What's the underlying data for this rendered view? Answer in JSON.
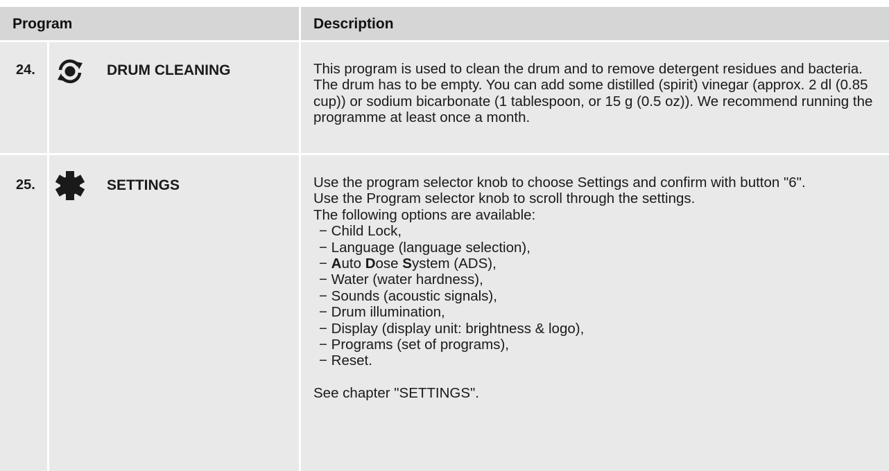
{
  "header": {
    "program_label": "Program",
    "description_label": "Description"
  },
  "rows": [
    {
      "number": "24.",
      "icon": "drum-cleaning-icon",
      "name": "DRUM CLEANING",
      "description": "This program is used to clean the drum and to remove detergent residues and bacteria. The drum has to be empty. You can add some distilled (spirit) vinegar (approx. 2 dl (0.85 cup)) or sodium bicarbonate (1 tablespoon, or 15 g (0.5 oz)). We recommend running the programme at least once a month."
    },
    {
      "number": "25.",
      "icon": "gear-icon",
      "name": "SETTINGS",
      "intro_lines": [
        "Use the program selector knob to choose Settings and confirm with button \"6\".",
        "Use the Program selector knob to scroll through the settings.",
        "The following options are available:"
      ],
      "options": [
        "Child Lock,",
        "Language (language selection),",
        "Water (water hardness),",
        "Sounds (acoustic signals),",
        "Drum illumination,",
        "Display (display unit: brightness & logo),",
        "Programs (set of programs),",
        "Reset."
      ],
      "ads_option": {
        "a_bold": "A",
        "a_rest": "uto ",
        "d_bold": "D",
        "d_rest": "ose ",
        "s_bold": "S",
        "s_rest": "ystem (ADS),"
      },
      "footer": "See chapter \"SETTINGS\"."
    }
  ]
}
